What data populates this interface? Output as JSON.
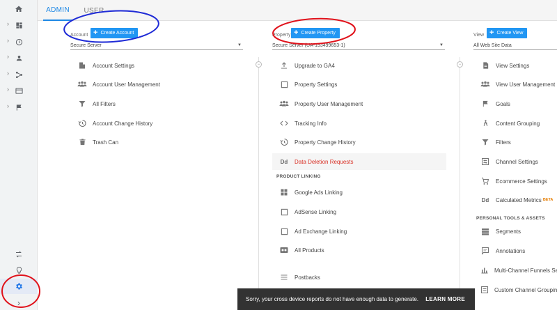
{
  "tabs": [
    {
      "label": "ADMIN",
      "active": true
    },
    {
      "label": "USER",
      "active": false
    }
  ],
  "rail": [
    {
      "icon": "home-icon"
    },
    {
      "icon": "dashboard-icon"
    },
    {
      "icon": "clock-icon"
    },
    {
      "icon": "person-icon"
    },
    {
      "icon": "acquisition-icon"
    },
    {
      "icon": "behavior-icon"
    },
    {
      "icon": "flag-icon"
    },
    {
      "icon": "discover-icon"
    },
    {
      "icon": "lightbulb-icon"
    },
    {
      "icon": "gear-icon"
    },
    {
      "icon": "expand-icon"
    }
  ],
  "account": {
    "label": "Account",
    "create_label": "Create Account",
    "selected": "Secure Server",
    "items": [
      {
        "label": "Account Settings",
        "icon": "building-icon"
      },
      {
        "label": "Account User Management",
        "icon": "people-icon"
      },
      {
        "label": "All Filters",
        "icon": "filter-icon"
      },
      {
        "label": "Account Change History",
        "icon": "history-icon"
      },
      {
        "label": "Trash Can",
        "icon": "trash-icon"
      }
    ]
  },
  "property": {
    "label": "Property",
    "create_label": "Create Property",
    "selected": "Secure Server (UA-153499653-1)",
    "items": [
      {
        "label": "Upgrade to GA4",
        "icon": "upload-icon"
      },
      {
        "label": "Property Settings",
        "icon": "square-icon"
      },
      {
        "label": "Property User Management",
        "icon": "people-icon"
      },
      {
        "label": "Tracking Info",
        "icon": "code-icon"
      },
      {
        "label": "Property Change History",
        "icon": "history-icon"
      },
      {
        "label": "Data Deletion Requests",
        "icon": "dd-icon"
      }
    ],
    "product_linking_heading": "PRODUCT LINKING",
    "linking": [
      {
        "label": "Google Ads Linking",
        "icon": "grid-icon"
      },
      {
        "label": "AdSense Linking",
        "icon": "square-icon"
      },
      {
        "label": "Ad Exchange Linking",
        "icon": "square-icon"
      },
      {
        "label": "All Products",
        "icon": "products-icon"
      },
      {
        "label": "Postbacks",
        "icon": "postbacks-icon"
      }
    ]
  },
  "view": {
    "label": "View",
    "create_label": "Create View",
    "selected": "All Web Site Data",
    "items": [
      {
        "label": "View Settings",
        "icon": "document-icon"
      },
      {
        "label": "View User Management",
        "icon": "people-icon"
      },
      {
        "label": "Goals",
        "icon": "flag-icon"
      },
      {
        "label": "Content Grouping",
        "icon": "person-walk-icon"
      },
      {
        "label": "Filters",
        "icon": "filter-icon"
      },
      {
        "label": "Channel Settings",
        "icon": "sliders-icon"
      },
      {
        "label": "Ecommerce Settings",
        "icon": "cart-icon"
      },
      {
        "label": "Calculated Metrics",
        "icon": "dd-icon",
        "badge": "BETA"
      }
    ],
    "personal_heading": "PERSONAL TOOLS & ASSETS",
    "personal": [
      {
        "label": "Segments",
        "icon": "segments-icon"
      },
      {
        "label": "Annotations",
        "icon": "comment-icon"
      },
      {
        "label": "Multi-Channel Funnels Settin",
        "icon": "bar-chart-icon"
      },
      {
        "label": "Custom Channel Grouping",
        "icon": "sliders-icon"
      }
    ]
  },
  "snackbar": {
    "message": "Sorry, your cross device reports do not have enough data to generate.",
    "action": "LEARN MORE"
  },
  "colors": {
    "accent": "#2196f3",
    "annotation_blue": "#1f2bd6",
    "annotation_red": "#e0121b"
  }
}
